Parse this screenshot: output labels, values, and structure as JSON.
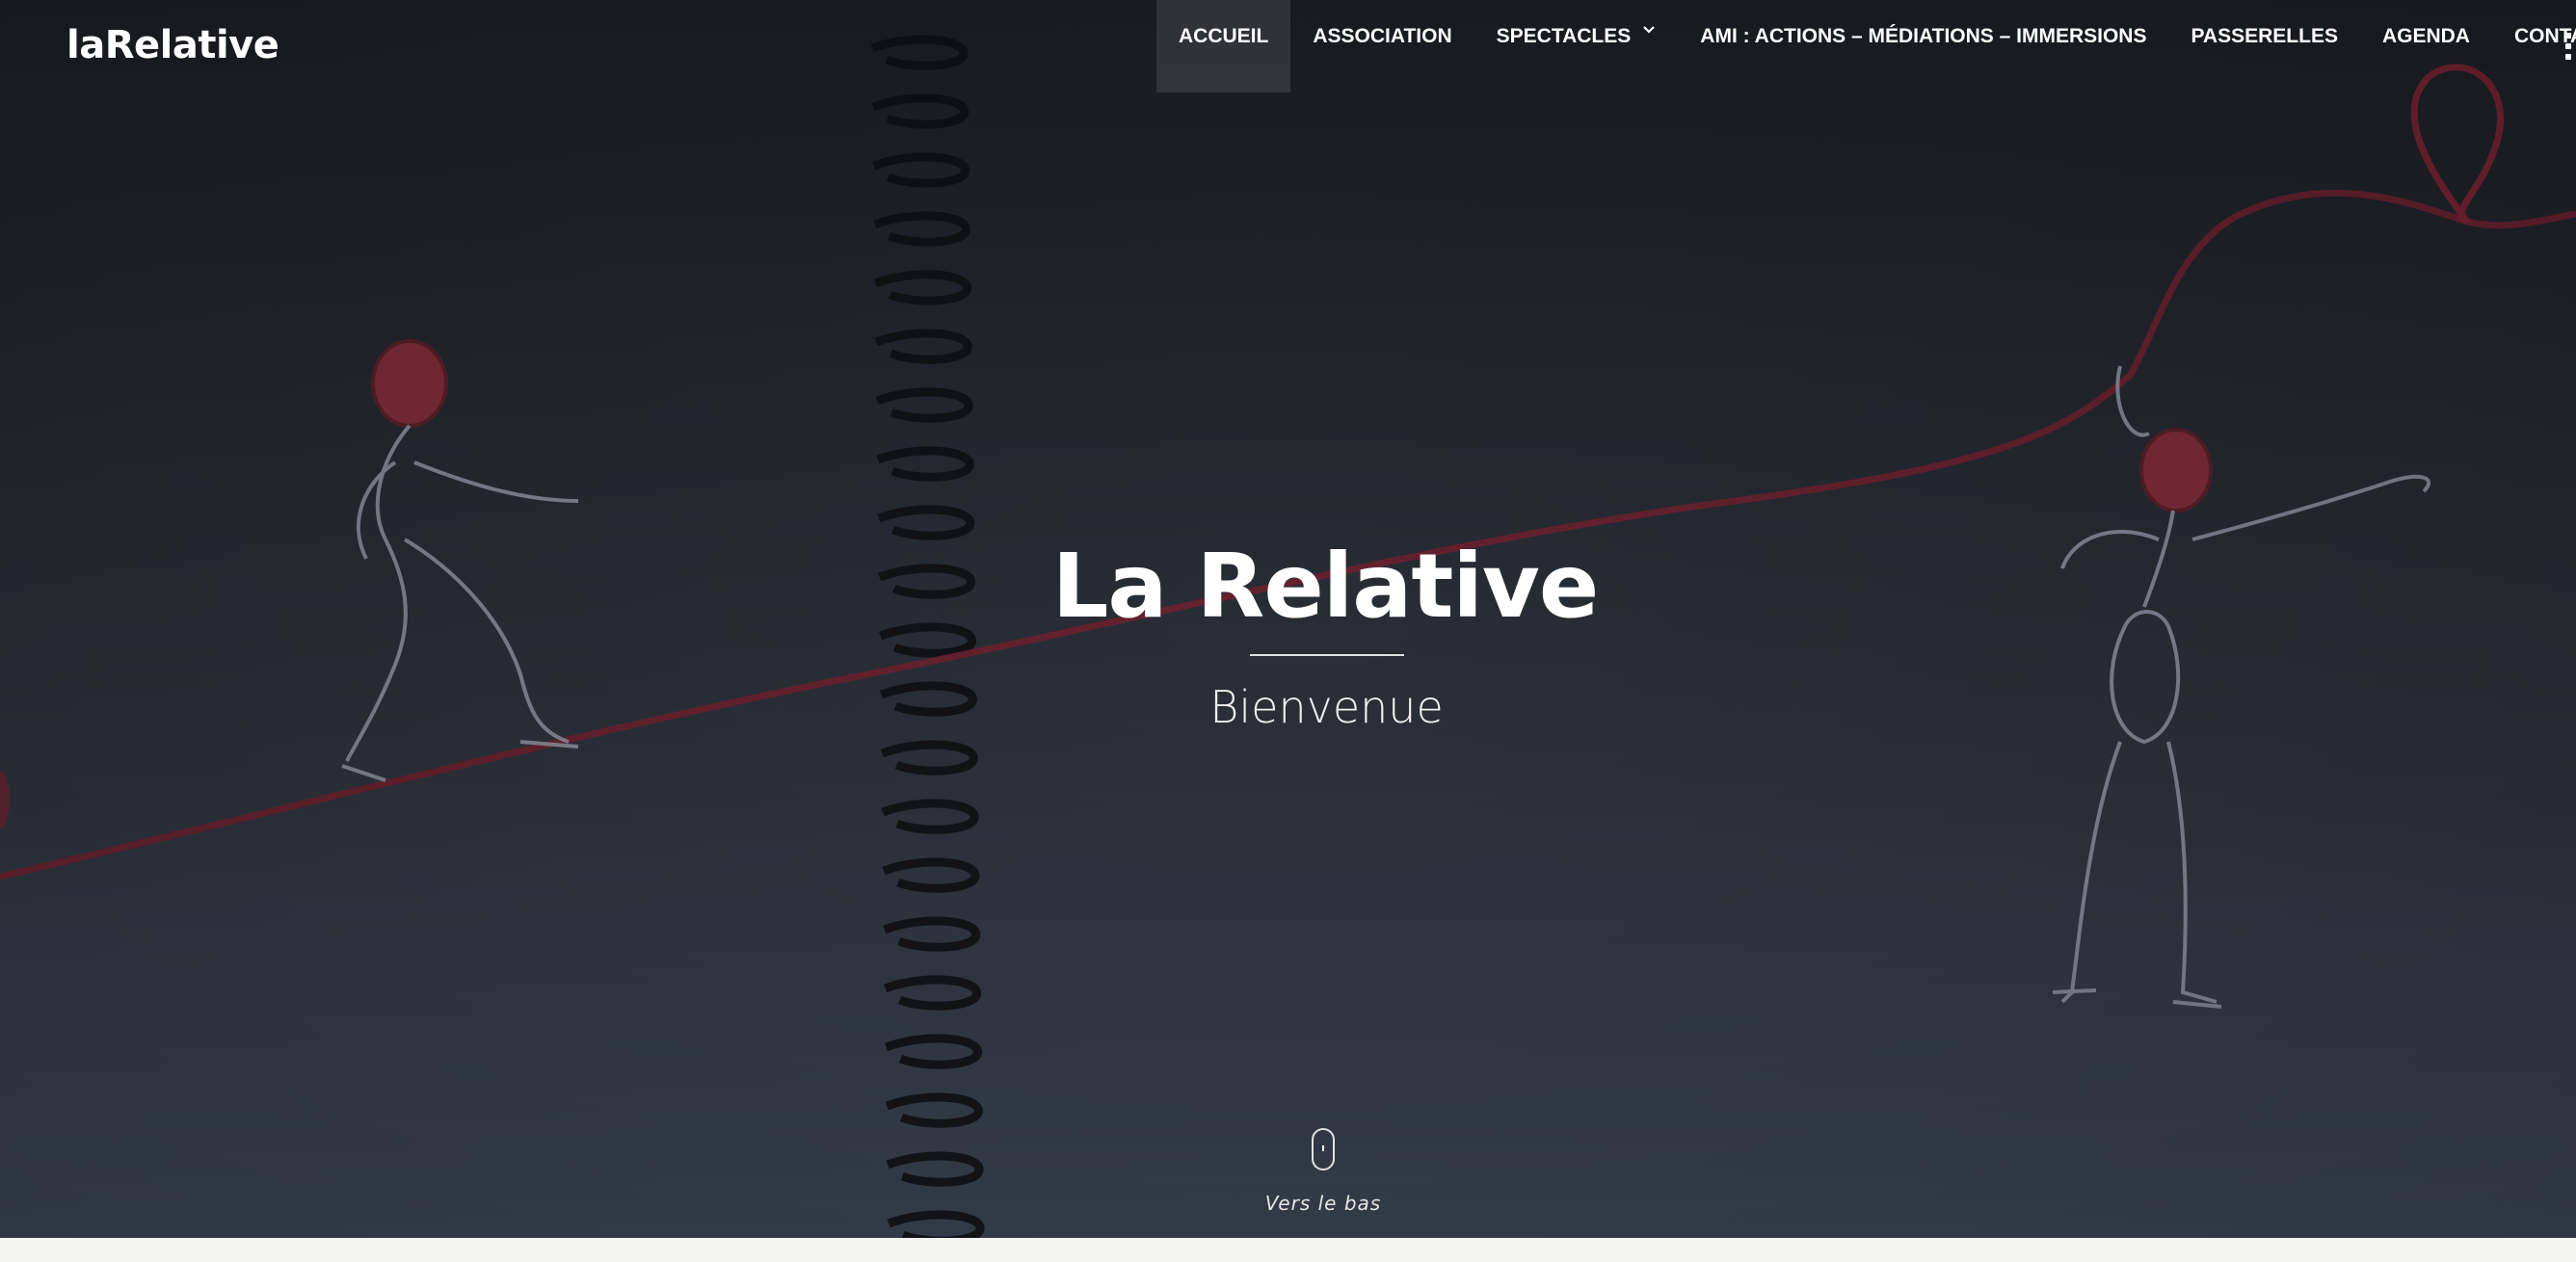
{
  "site": {
    "logo": "laRelative"
  },
  "nav": {
    "items": [
      {
        "label": "ACCUEIL",
        "active": true
      },
      {
        "label": "ASSOCIATION"
      },
      {
        "label": "SPECTACLES",
        "has_dropdown": true
      },
      {
        "label": "AMI : ACTIONS – MÉDIATIONS – IMMERSIONS"
      },
      {
        "label": "PASSERELLES"
      },
      {
        "label": "AGENDA"
      },
      {
        "label": "CONTACT"
      }
    ],
    "menu_icon": "vertical-dots-menu-icon"
  },
  "hero": {
    "title": "La Relative",
    "subtitle": "Bienvenue",
    "scroll_label": "Vers le bas",
    "scroll_icon": "mouse-scroll-icon",
    "background": "photo-wire-figures-on-red-thread"
  },
  "colors": {
    "text": "#ffffff",
    "thread": "#7a2233",
    "background_top": "#1b1e23",
    "background_bottom": "#3a4352",
    "bottom_band": "#f3f3f1"
  }
}
